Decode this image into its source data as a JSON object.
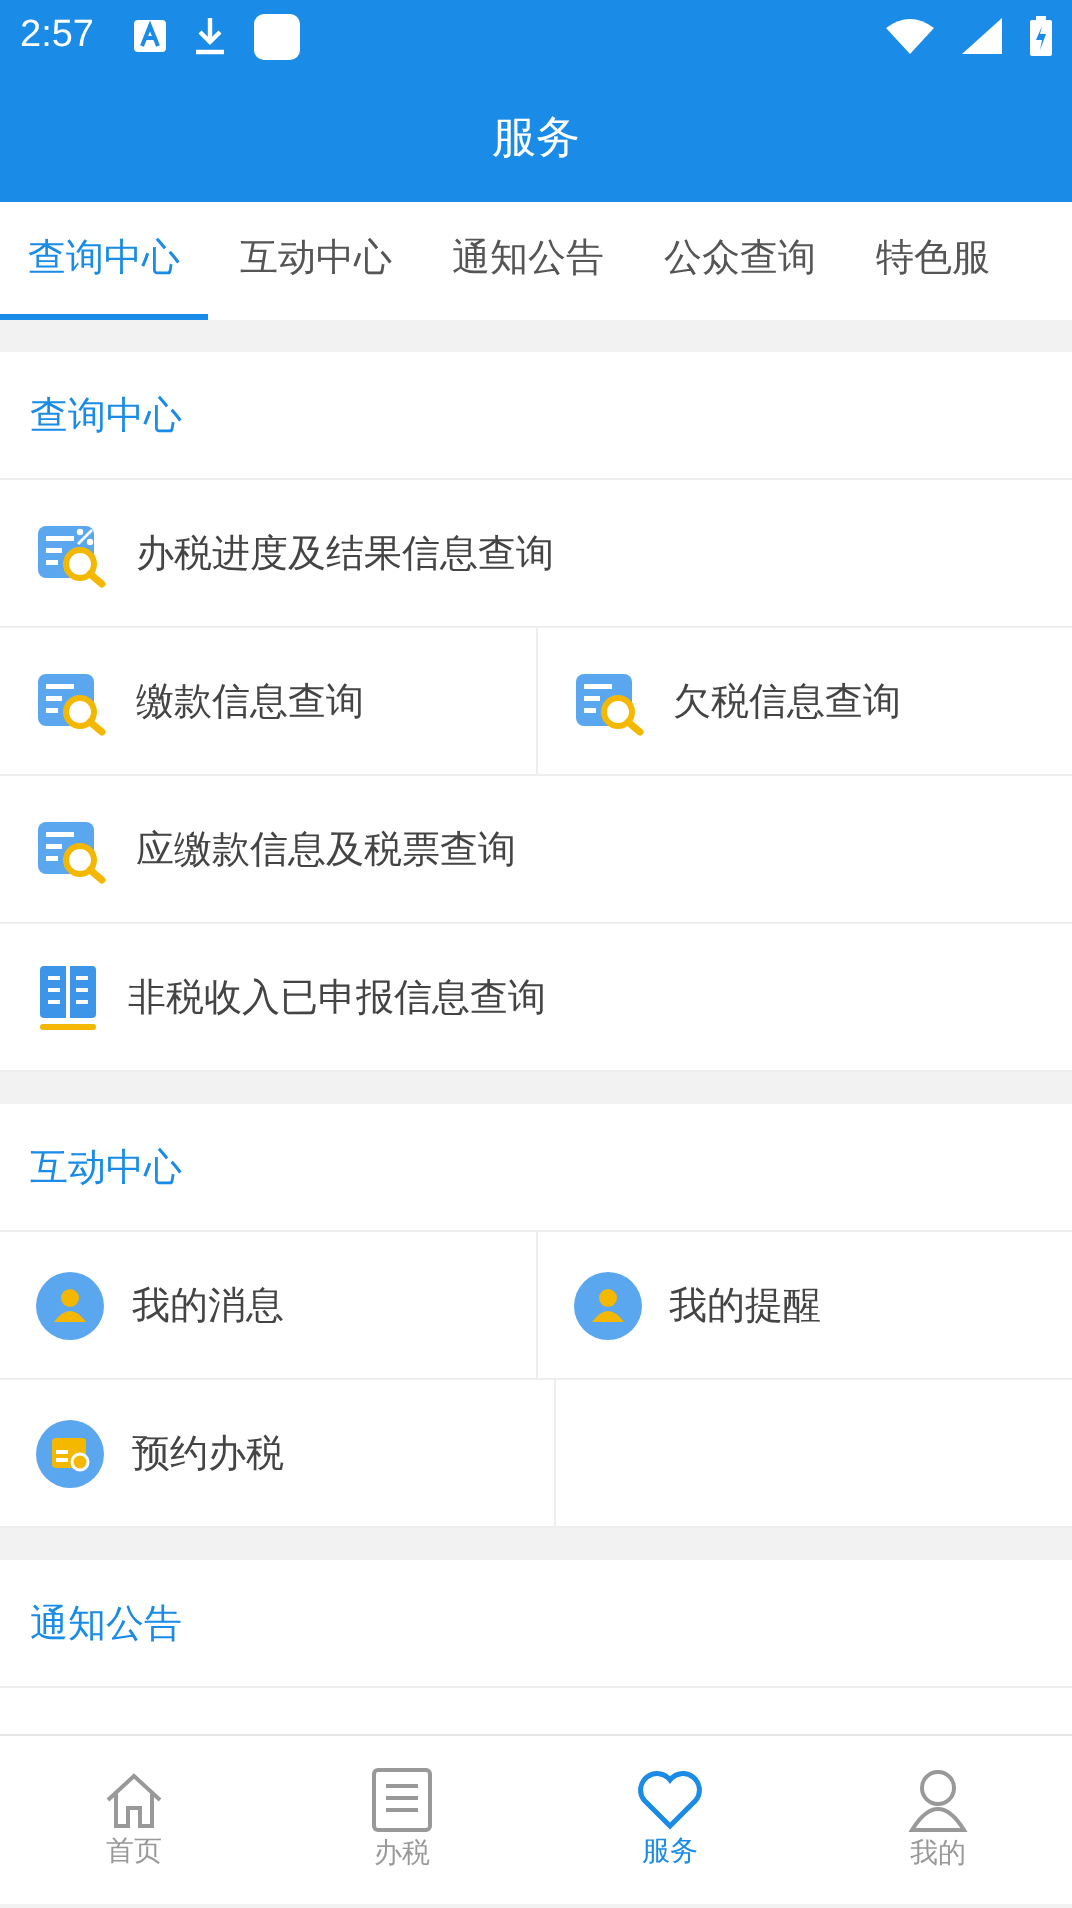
{
  "status_bar": {
    "time": "2:57"
  },
  "header": {
    "title": "服务"
  },
  "tabs": [
    {
      "label": "查询中心",
      "selected": true
    },
    {
      "label": "互动中心",
      "selected": false
    },
    {
      "label": "通知公告",
      "selected": false
    },
    {
      "label": "公众查询",
      "selected": false
    },
    {
      "label": "特色服",
      "selected": false
    }
  ],
  "sections": [
    {
      "title": "查询中心",
      "rows": [
        [
          "办税进度及结果信息查询"
        ],
        [
          "缴款信息查询",
          "欠税信息查询"
        ],
        [
          "应缴款信息及税票查询"
        ],
        [
          "非税收入已申报信息查询"
        ]
      ]
    },
    {
      "title": "互动中心",
      "rows": [
        [
          "我的消息",
          "我的提醒"
        ],
        [
          "预约办税",
          null
        ]
      ]
    },
    {
      "title": "通知公告"
    }
  ],
  "bottom_nav": [
    {
      "label": "首页",
      "selected": false
    },
    {
      "label": "办税",
      "selected": false
    },
    {
      "label": "服务",
      "selected": true
    },
    {
      "label": "我的",
      "selected": false
    }
  ]
}
